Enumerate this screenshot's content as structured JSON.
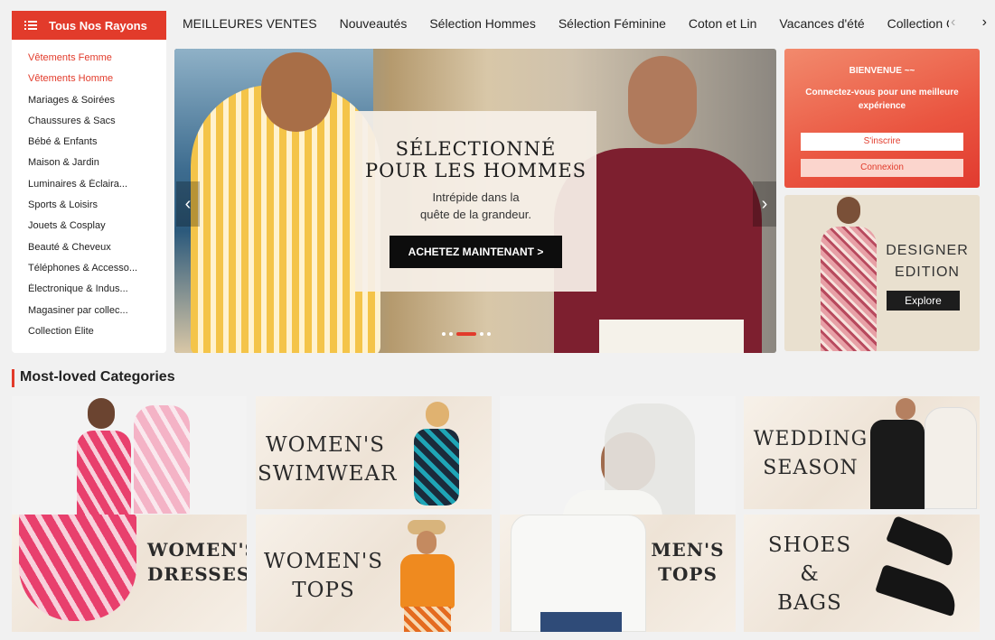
{
  "nav": {
    "rayons_label": "Tous Nos Rayons",
    "links": [
      "MEILLEURES VENTES",
      "Nouveautés",
      "Sélection Hommes",
      "Sélection Féminine",
      "Coton et Lin",
      "Vacances d'été",
      "Collection Occasion"
    ],
    "prev_icon": "chevron-left-icon",
    "next_icon": "chevron-right-icon"
  },
  "sidebar": {
    "items": [
      {
        "label": "Vêtements Femme",
        "highlight": true
      },
      {
        "label": "Vêtements Homme",
        "highlight": true
      },
      {
        "label": "Mariages & Soirées"
      },
      {
        "label": "Chaussures & Sacs"
      },
      {
        "label": "Bébé & Enfants"
      },
      {
        "label": "Maison & Jardin"
      },
      {
        "label": "Luminaires & Éclaira..."
      },
      {
        "label": "Sports & Loisirs"
      },
      {
        "label": "Jouets & Cosplay"
      },
      {
        "label": "Beauté & Cheveux"
      },
      {
        "label": "Téléphones & Accesso..."
      },
      {
        "label": "Électronique & Indus..."
      },
      {
        "label": "Magasiner par collec..."
      },
      {
        "label": "Collection Élite"
      }
    ]
  },
  "hero": {
    "title_line1": "SÉLECTIONNÉ",
    "title_line2": "POUR LES HOMMES",
    "subtitle_line1": "Intrépide dans la",
    "subtitle_line2": "quête de la grandeur.",
    "cta": "ACHETEZ MAINTENANT >",
    "slides": 5,
    "active_slide": 3
  },
  "welcome": {
    "heading": "BIENVENUE ~~",
    "text": "Connectez-vous pour une meilleure expérience",
    "signup": "S'inscrire",
    "login": "Connexion"
  },
  "designer": {
    "line1": "DESIGNER",
    "line2": "EDITION",
    "button": "Explore"
  },
  "section": {
    "title": "Most-loved Categories"
  },
  "categories": {
    "swimwear": {
      "l1": "WOMEN'S",
      "l2": "SWIMWEAR"
    },
    "wedding": {
      "l1": "WEDDING",
      "l2": "SEASON"
    },
    "dresses": {
      "l1": "WOMEN'S",
      "l2": "DRESSES"
    },
    "wtops": {
      "l1": "WOMEN'S",
      "l2": "TOPS"
    },
    "mtops": {
      "l1": "MEN'S",
      "l2": "TOPS"
    },
    "shoes": {
      "l1": "SHOES",
      "l2": "&",
      "l3": "BAGS"
    }
  },
  "colors": {
    "accent": "#e23b2b"
  }
}
